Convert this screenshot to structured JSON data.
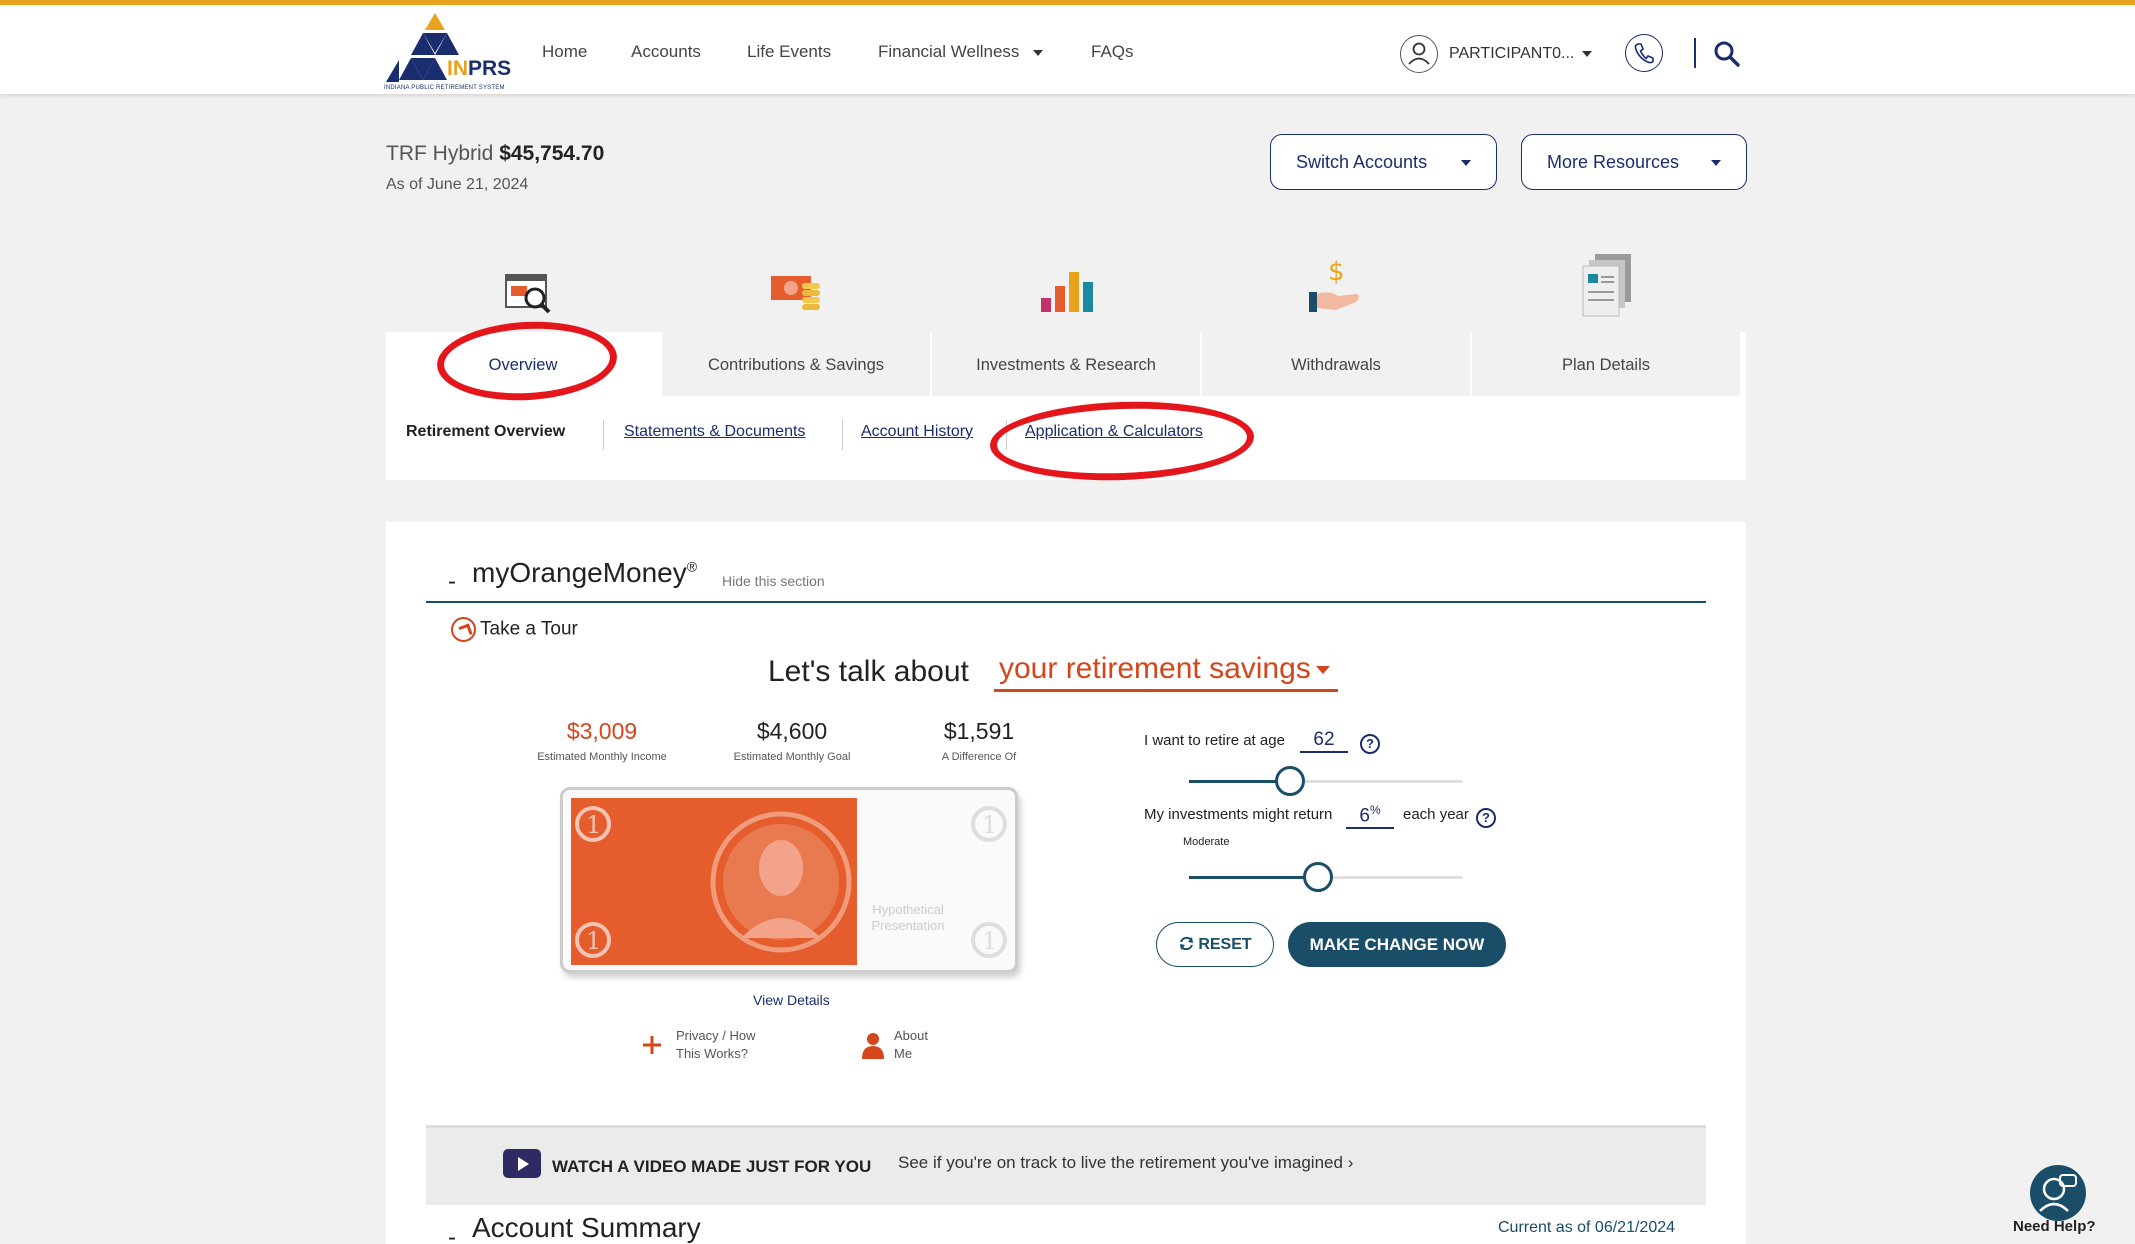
{
  "header": {
    "logo_text_main": "IN",
    "logo_text_accent": "PRS",
    "logo_subtitle": "INDIANA PUBLIC RETIREMENT SYSTEM",
    "nav": [
      "Home",
      "Accounts",
      "Life Events",
      "Financial Wellness",
      "FAQs"
    ],
    "user_name": "PARTICIPANT0..."
  },
  "account": {
    "plan": "TRF Hybrid",
    "balance": "$45,754.70",
    "as_of": "As of June 21, 2024",
    "switch_accounts": "Switch Accounts",
    "more_resources": "More Resources"
  },
  "tabs": [
    {
      "label": "Overview",
      "icon": "search-document-icon",
      "active": true
    },
    {
      "label": "Contributions & Savings",
      "icon": "money-coins-icon",
      "active": false
    },
    {
      "label": "Investments & Research",
      "icon": "bar-chart-icon",
      "active": false
    },
    {
      "label": "Withdrawals",
      "icon": "hand-dollar-icon",
      "active": false
    },
    {
      "label": "Plan Details",
      "icon": "documents-icon",
      "active": false
    }
  ],
  "subnav": [
    "Retirement Overview",
    "Statements & Documents",
    "Account History",
    "Application & Calculators"
  ],
  "orange_money": {
    "title": "myOrangeMoney",
    "title_mark": "®",
    "hide_label": "Hide this section",
    "tour": "Take a Tour",
    "talk_prefix": "Let's talk about",
    "talk_topic": "your retirement savings",
    "stats": [
      {
        "value": "$3,009",
        "label": "Estimated Monthly Income",
        "color": "#d4451b"
      },
      {
        "value": "$4,600",
        "label": "Estimated Monthly Goal",
        "color": "#222222"
      },
      {
        "value": "$1,591",
        "label": "A Difference Of",
        "color": "#222222"
      }
    ],
    "bill_fill_fraction": 0.65,
    "bill_watermark": "Hypothetical Presentation",
    "view_details": "View Details",
    "privacy": "Privacy / How This Works?",
    "about": "About Me",
    "retire_label": "I want to retire at age",
    "retire_age": "62",
    "retire_slider_fraction": 0.37,
    "return_label": "My investments might return",
    "return_value": "6",
    "return_unit": "%",
    "return_suffix": "each year",
    "risk_level": "Moderate",
    "return_slider_fraction": 0.47,
    "reset": "RESET",
    "make_change": "MAKE CHANGE NOW"
  },
  "video": {
    "title": "WATCH A VIDEO MADE JUST FOR YOU",
    "link": "See if you're on track to live the retirement you've imagined"
  },
  "account_summary": {
    "title": "Account Summary",
    "current": "Current as of 06/21/2024"
  },
  "help": "Need Help?",
  "colors": {
    "accent": "#d4451b",
    "brand_navy": "#1a2d6e",
    "teal": "#1a4d68",
    "gold": "#e8a21b",
    "annotation_red": "#e4161b"
  }
}
